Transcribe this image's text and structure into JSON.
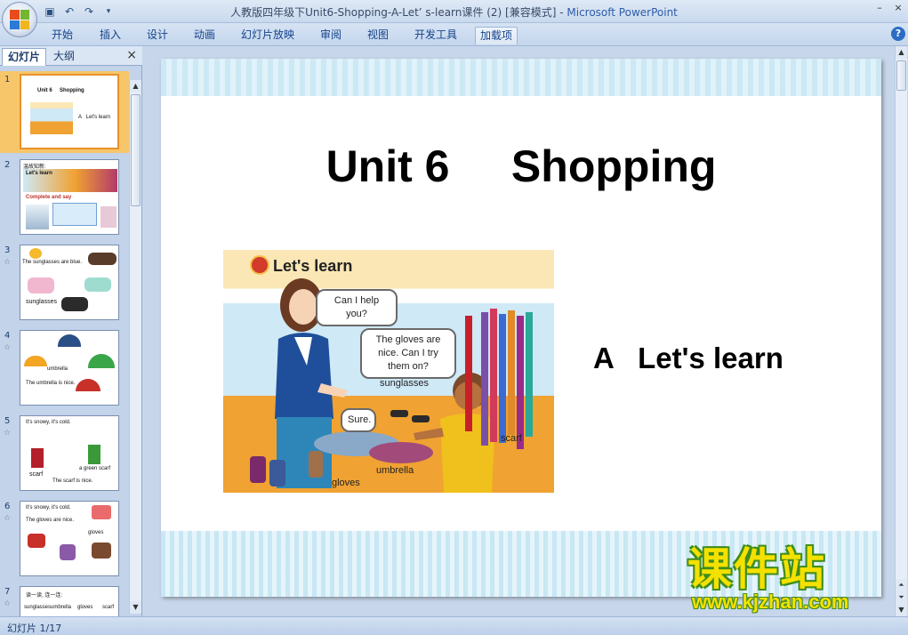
{
  "window": {
    "title": "人教版四年级下Unit6-Shopping-A-Let’  s-learn课件 (2) [兼容模式]",
    "app_name": "Microsoft PowerPoint"
  },
  "ribbon": {
    "tabs": [
      "开始",
      "插入",
      "设计",
      "动画",
      "幻灯片放映",
      "审阅",
      "视图",
      "开发工具",
      "加载项"
    ],
    "active_tab": "加载项"
  },
  "panel": {
    "tabs": [
      "幻灯片",
      "大纲"
    ],
    "close_label": "×"
  },
  "thumbnails": [
    {
      "num": "1",
      "title": "Unit 6     Shopping",
      "sub": "A   Let's learn"
    },
    {
      "num": "2",
      "t1": "温故知新:",
      "t2": "Let's learn",
      "t3": "Complete and say"
    },
    {
      "num": "3",
      "t1": "The sunglasses are blue.",
      "t2": "sunglasses"
    },
    {
      "num": "4",
      "t1": "umbrella",
      "t2": "The umbrella is nice."
    },
    {
      "num": "5",
      "t1": "It's snowy, it's cold.",
      "t2": "a green scarf",
      "t3": "scarf",
      "t4": "The scarf is nice."
    },
    {
      "num": "6",
      "t1": "It's snowy, it's cold.",
      "t2": "The gloves are nice.",
      "t3": "gloves"
    },
    {
      "num": "7",
      "t1": "读一读, 连一连:",
      "t2": "sunglasses",
      "t3": "umbrella",
      "t4": "gloves",
      "t5": "scarf"
    }
  ],
  "slide": {
    "title": "Unit 6     Shopping",
    "subtitle": "A   Let's learn",
    "picture": {
      "heading": "Let's learn",
      "bubble1": "Can I help you?",
      "bubble2": "The gloves are nice. Can I try them on?",
      "bubble3": "Sure.",
      "labels": {
        "sunglasses": "sunglasses",
        "scarf": "scarf",
        "umbrella": "umbrella",
        "gloves": "gloves"
      }
    }
  },
  "watermark": {
    "chinese": "课件站",
    "url": "www.kjzhan.com"
  },
  "status": {
    "slide_position": "幻灯片 1/17"
  },
  "colors": {
    "accent": "#15428b",
    "selected_thumb": "#f7c66a",
    "watermark_yellow": "#f5e100",
    "watermark_green": "#3f8d1e"
  }
}
